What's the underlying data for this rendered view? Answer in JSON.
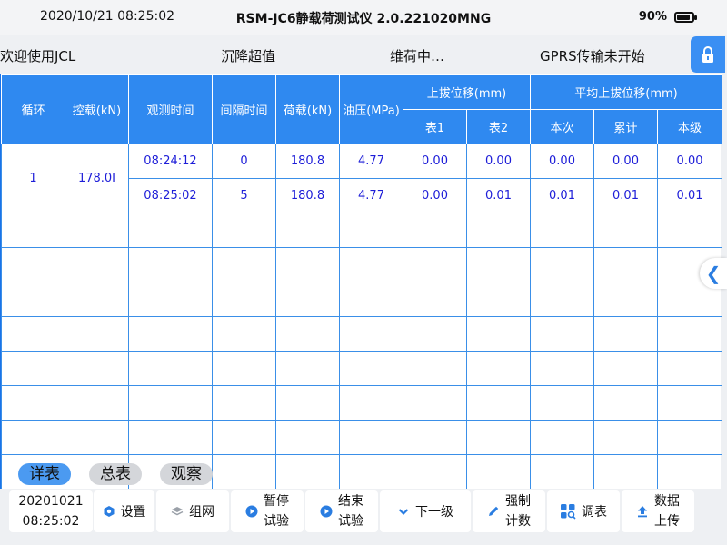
{
  "status": {
    "time": "2020/10/21 08:25:02",
    "title": "RSM-JC6静载荷测试仪 2.0.221020MNG",
    "battery": "90%",
    "battery_level": 0.9
  },
  "info": {
    "welcome": "欢迎使用JCL",
    "settle": "沉降超值",
    "holding": "维荷中…",
    "gprs": "GPRS传输未开始"
  },
  "table": {
    "headers": {
      "cycle": "循环",
      "control": "控载(kN)",
      "obs_time": "观测时间",
      "interval": "间隔时间",
      "load": "荷载(kN)",
      "oil": "油压(MPa)",
      "uplift": "上拔位移(mm)",
      "gauge1": "表1",
      "gauge2": "表2",
      "avg_uplift": "平均上拔位移(mm)",
      "this": "本次",
      "cum": "累计",
      "level": "本级"
    },
    "group": {
      "cycle": "1",
      "control": "178.0I"
    },
    "rows": [
      {
        "time": "08:24:12",
        "interval": "0",
        "load": "180.8",
        "oil": "4.77",
        "g1": "0.00",
        "g2": "0.00",
        "this": "0.00",
        "cum": "0.00",
        "level": "0.00"
      },
      {
        "time": "08:25:02",
        "interval": "5",
        "load": "180.8",
        "oil": "4.77",
        "g1": "0.00",
        "g2": "0.01",
        "this": "0.01",
        "cum": "0.01",
        "level": "0.01"
      }
    ]
  },
  "tabs": [
    "详表",
    "总表",
    "观察"
  ],
  "toolbar": {
    "date": "20201021",
    "time": "08:25:02",
    "settings": "设置",
    "network": "组网",
    "pause1": "暂停",
    "pause2": "试验",
    "end1": "结束",
    "end2": "试验",
    "next": "下一级",
    "force1": "强制",
    "force2": "计数",
    "adjust": "调表",
    "upload1": "数据",
    "upload2": "上传"
  },
  "colors": {
    "accent": "#2f89f0",
    "value_text": "#1d1dd8"
  }
}
